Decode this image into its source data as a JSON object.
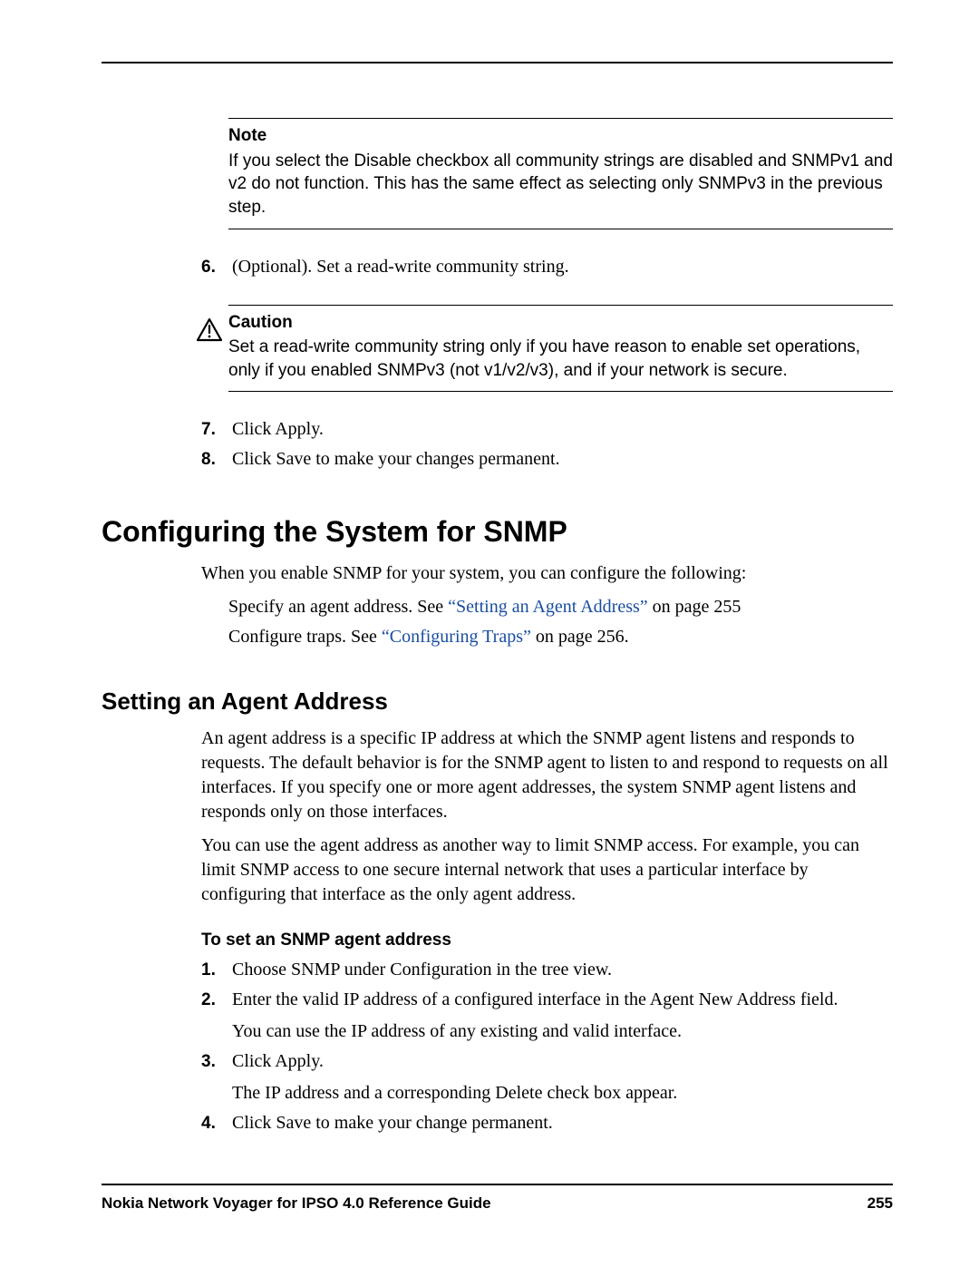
{
  "callouts": {
    "note": {
      "title": "Note",
      "body": "If you select the Disable checkbox all community strings are disabled and SNMPv1 and v2 do not function. This has the same effect as selecting only SNMPv3 in the previous step."
    },
    "caution": {
      "title": "Caution",
      "body": "Set a read-write community string only if you have reason to enable set operations, only if you enabled SNMPv3 (not v1/v2/v3), and if your network is secure."
    }
  },
  "steps_top": {
    "n6": "6.",
    "t6": "(Optional). Set a read-write community string.",
    "n7": "7.",
    "t7": "Click Apply.",
    "n8": "8.",
    "t8": "Click Save to make your changes permanent."
  },
  "section_h1": "Configuring the System for SNMP",
  "intro": "When you enable SNMP for your system, you can configure the following:",
  "bullets": {
    "b1_pre": "Specify an agent address. See ",
    "b1_link": "“Setting an Agent Address”",
    "b1_post": " on page 255",
    "b2_pre": "Configure traps. See ",
    "b2_link": "“Configuring Traps”",
    "b2_post": " on page 256."
  },
  "subsection_h2": "Setting an Agent Address",
  "agent_p1": "An agent address is a specific IP address at which the SNMP agent listens and responds to requests. The default behavior is for the SNMP agent to listen to and respond to requests on all interfaces. If you specify one or more agent addresses, the system SNMP agent listens and responds only on those interfaces.",
  "agent_p2": "You can use the agent address as another way to limit SNMP access. For example, you can limit SNMP access to one secure internal network that uses a particular interface by configuring that interface as the only agent address.",
  "task_h3": "To set an SNMP agent address",
  "steps_agent": {
    "n1": "1.",
    "t1": "Choose SNMP under Configuration in the tree view.",
    "n2": "2.",
    "t2": "Enter the valid IP address of a configured interface in the Agent New Address field.",
    "s2": "You can use the IP address of any existing and valid interface.",
    "n3": "3.",
    "t3": "Click Apply.",
    "s3": "The IP address and a corresponding Delete check box appear.",
    "n4": "4.",
    "t4": "Click Save to make your change permanent."
  },
  "footer": {
    "title": "Nokia Network Voyager for IPSO 4.0 Reference Guide",
    "page": "255"
  },
  "icons": {
    "caution": "caution-icon"
  }
}
